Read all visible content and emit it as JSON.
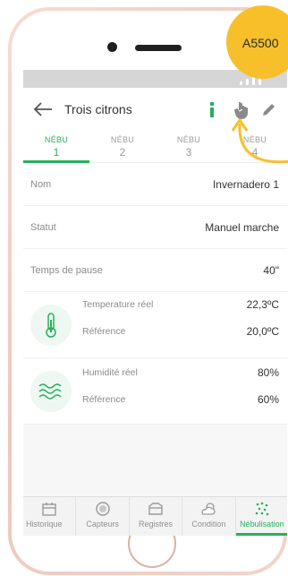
{
  "badge": {
    "text": "A5500"
  },
  "appbar": {
    "title": "Trois citrons"
  },
  "tabs": [
    {
      "label": "NÉBU",
      "num": "1"
    },
    {
      "label": "NÉBU",
      "num": "2"
    },
    {
      "label": "NÉBU",
      "num": "3"
    },
    {
      "label": "NÉBU",
      "num": "4"
    }
  ],
  "fields": {
    "nom": {
      "label": "Nom",
      "value": "Invernadero 1"
    },
    "statut": {
      "label": "Statut",
      "value": "Manuel marche"
    },
    "pause": {
      "label": "Temps de pause",
      "value": "40\""
    }
  },
  "temperature": {
    "real_label": "Temperature réel",
    "real_value": "22,3ºC",
    "ref_label": "Référence",
    "ref_value": "20,0ºC"
  },
  "humidity": {
    "real_label": "Humidité réel",
    "real_value": "80%",
    "ref_label": "Référence",
    "ref_value": "60%"
  },
  "nav": [
    {
      "label": "Historique",
      "icon": "calendar-icon"
    },
    {
      "label": "Capteurs",
      "icon": "sensor-icon"
    },
    {
      "label": "Registres",
      "icon": "folder-icon"
    },
    {
      "label": "Condition",
      "icon": "weather-icon"
    },
    {
      "label": "Nébulisation",
      "icon": "mist-icon"
    }
  ],
  "colors": {
    "accent": "#26b05c",
    "badge": "#f7c02b",
    "phone_frame": "#edc7bc"
  }
}
